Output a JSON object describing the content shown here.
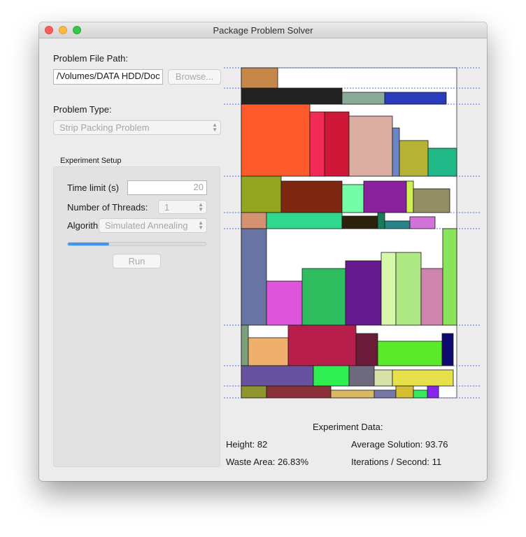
{
  "window": {
    "title": "Package Problem Solver"
  },
  "file": {
    "label": "Problem File Path:",
    "path": "/Volumes/DATA HDD/Doc",
    "browse_label": "Browse..."
  },
  "problem_type": {
    "label": "Problem Type:",
    "value": "Strip Packing Problem"
  },
  "experiment_setup": {
    "title": "Experiment Setup",
    "time_limit_label": "Time limit (s)",
    "time_limit_value": "20",
    "threads_label": "Number of Threads:",
    "threads_value": "1",
    "algorithm_label": "Algorithm:",
    "algorithm_value": "Simulated Annealing",
    "progress_fraction": 0.3,
    "run_label": "Run"
  },
  "experiment_data": {
    "title": "Experiment Data:",
    "height": "Height: 82",
    "waste_area": "Waste Area: 26.83%",
    "average_solution": "Average Solution: 93.76",
    "iterations": "Iterations / Second: 11"
  }
}
